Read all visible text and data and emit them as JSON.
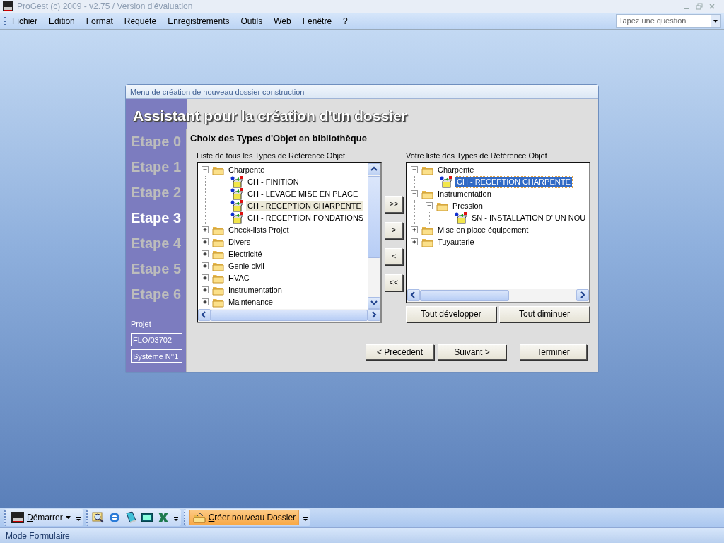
{
  "window": {
    "title": "ProGest (c) 2009 - v2.75 / Version d'évaluation"
  },
  "menu": [
    {
      "label": [
        {
          "text": "F",
          "underlined": true
        },
        {
          "text": "ichier",
          "underlined": false
        }
      ]
    },
    {
      "label": [
        {
          "text": "E",
          "underlined": true
        },
        {
          "text": "dition",
          "underlined": false
        }
      ]
    },
    {
      "label": [
        {
          "text": "Forma",
          "underlined": false
        },
        {
          "text": "t",
          "underlined": true
        }
      ]
    },
    {
      "label": [
        {
          "text": "R",
          "underlined": true
        },
        {
          "text": "equête",
          "underlined": false
        }
      ]
    },
    {
      "label": [
        {
          "text": "E",
          "underlined": true
        },
        {
          "text": "nregistrements",
          "underlined": false
        }
      ]
    },
    {
      "label": [
        {
          "text": "O",
          "underlined": true
        },
        {
          "text": "utils",
          "underlined": false
        }
      ]
    },
    {
      "label": [
        {
          "text": "W",
          "underlined": true
        },
        {
          "text": "eb",
          "underlined": false
        }
      ]
    },
    {
      "label": [
        {
          "text": "Fe",
          "underlined": false
        },
        {
          "text": "n",
          "underlined": true
        },
        {
          "text": "être",
          "underlined": false
        }
      ]
    },
    {
      "label": [
        {
          "text": "?",
          "underlined": false
        }
      ]
    }
  ],
  "help_box": {
    "placeholder": "Tapez une question"
  },
  "dialog": {
    "title": "Menu de création de nouveau dossier construction",
    "heading": "Assistant pour la création d'un dossier",
    "steps": [
      {
        "label": "Etape 0",
        "selected": false
      },
      {
        "label": "Etape 1",
        "selected": false
      },
      {
        "label": "Etape 2",
        "selected": false
      },
      {
        "label": "Etape 3",
        "selected": true
      },
      {
        "label": "Etape 4",
        "selected": false
      },
      {
        "label": "Etape 5",
        "selected": false
      },
      {
        "label": "Etape 6",
        "selected": false
      }
    ],
    "project_label": "Projet",
    "project_fields": [
      "FLO/03702",
      "Système N°1"
    ],
    "subheading": "Choix des Types d'Objet en bibliothèque",
    "library": {
      "label": "Liste de tous les Types de Référence Objet",
      "focused": false,
      "tree": [
        {
          "kind": "folder",
          "label": "Charpente",
          "expanded": true,
          "selected": false,
          "children": [
            {
              "kind": "object",
              "label": "CH - FINITION",
              "selected": false
            },
            {
              "kind": "object",
              "label": "CH - LEVAGE MISE EN PLACE",
              "selected": false
            },
            {
              "kind": "object",
              "label": "CH - RECEPTION CHARPENTE",
              "selected": true
            },
            {
              "kind": "object",
              "label": "CH - RECEPTION FONDATIONS",
              "selected": false
            }
          ]
        },
        {
          "kind": "folder",
          "label": "Check-lists Projet",
          "expanded": false,
          "selected": false
        },
        {
          "kind": "folder",
          "label": "Divers",
          "expanded": false,
          "selected": false
        },
        {
          "kind": "folder",
          "label": "Electricité",
          "expanded": false,
          "selected": false
        },
        {
          "kind": "folder",
          "label": "Genie civil",
          "expanded": false,
          "selected": false
        },
        {
          "kind": "folder",
          "label": "HVAC",
          "expanded": false,
          "selected": false
        },
        {
          "kind": "folder",
          "label": "Instrumentation",
          "expanded": false,
          "selected": false
        },
        {
          "kind": "folder",
          "label": "Maintenance",
          "expanded": false,
          "selected": false
        }
      ]
    },
    "transfer_buttons": [
      ">>",
      ">",
      "<",
      "<<"
    ],
    "selection": {
      "label": "Votre liste des Types de Référence Objet",
      "focused": true,
      "tree": [
        {
          "kind": "folder",
          "label": "Charpente",
          "expanded": true,
          "selected": false,
          "children": [
            {
              "kind": "object",
              "label": "CH - RECEPTION CHARPENTE",
              "selected": true
            }
          ]
        },
        {
          "kind": "folder",
          "label": "Instrumentation",
          "expanded": true,
          "selected": false,
          "children": [
            {
              "kind": "folder",
              "label": "Pression",
              "expanded": true,
              "selected": false,
              "children": [
                {
                  "kind": "object",
                  "label": "SN - INSTALLATION D' UN NOU",
                  "selected": false
                }
              ]
            }
          ]
        },
        {
          "kind": "folder",
          "label": "Mise en place équipement",
          "expanded": false,
          "selected": false
        },
        {
          "kind": "folder",
          "label": "Tuyauterie",
          "expanded": false,
          "selected": false
        }
      ],
      "buttons": [
        "Tout développer",
        "Tout diminuer"
      ]
    },
    "nav_buttons": [
      "< Précédent",
      "Suivant >",
      "Terminer"
    ]
  },
  "taskbar": {
    "start": [
      {
        "text": "D",
        "underlined": true
      },
      {
        "text": "émarrer",
        "underlined": false
      }
    ],
    "task": [
      {
        "text": "C",
        "underlined": true
      },
      {
        "text": "réer nouveau Dossier",
        "underlined": false
      }
    ]
  },
  "status_bar": {
    "mode": "Mode Formulaire"
  }
}
